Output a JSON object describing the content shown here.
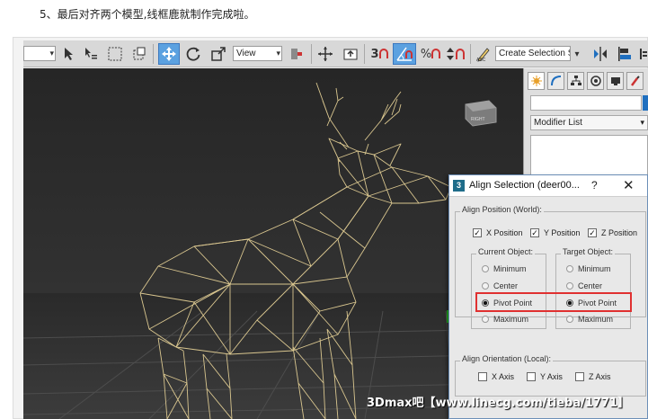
{
  "caption": "5、最后对齐两个模型,线框鹿就制作完成啦。",
  "toolbar": {
    "view_dropdown": "View",
    "selection_set": "Create Selection Se",
    "snap_3": "3",
    "percent_snap": "%",
    "icons": [
      "select-icon",
      "select-by-name-icon",
      "rect-region-icon",
      "window-crossing-icon",
      "move-icon",
      "rotate-icon",
      "scale-icon",
      "pivot-icon",
      "manipulate-icon",
      "keyboard-shortcut-icon",
      "snap-icon",
      "angle-snap-icon",
      "percent-snap-icon",
      "spinner-snap-icon",
      "edit-named-selection-icon",
      "mirror-icon",
      "align-icon"
    ]
  },
  "command_panel": {
    "tabs": [
      "create-tab",
      "modify-tab",
      "hierarchy-tab",
      "motion-tab",
      "display-tab",
      "utilities-tab"
    ],
    "modifier_list": "Modifier List"
  },
  "dialog": {
    "title": "Align Selection (deer00...",
    "help": "?",
    "close": "✕",
    "align_position": {
      "label": "Align Position (World):",
      "x": {
        "label": "X Position",
        "checked": true
      },
      "y": {
        "label": "Y Position",
        "checked": true
      },
      "z": {
        "label": "Z Position",
        "checked": true
      }
    },
    "current_object": {
      "label": "Current Object:",
      "options": [
        "Minimum",
        "Center",
        "Pivot Point",
        "Maximum"
      ],
      "selected": "Pivot Point"
    },
    "target_object": {
      "label": "Target Object:",
      "options": [
        "Minimum",
        "Center",
        "Pivot Point",
        "Maximum"
      ],
      "selected": "Pivot Point"
    },
    "align_orientation": {
      "label": "Align Orientation (Local):",
      "x": {
        "label": "X Axis",
        "checked": false
      },
      "y": {
        "label": "Y Axis",
        "checked": false
      },
      "z": {
        "label": "Z Axis",
        "checked": false
      }
    }
  },
  "watermark": "3Dmax吧【www.linecg.com/tieba/1771】",
  "colors": {
    "viewport_bg": "#2e2e2e",
    "wire": "#d9c68f",
    "active_tool": "#5ba1e0",
    "highlight": "#e03030"
  }
}
